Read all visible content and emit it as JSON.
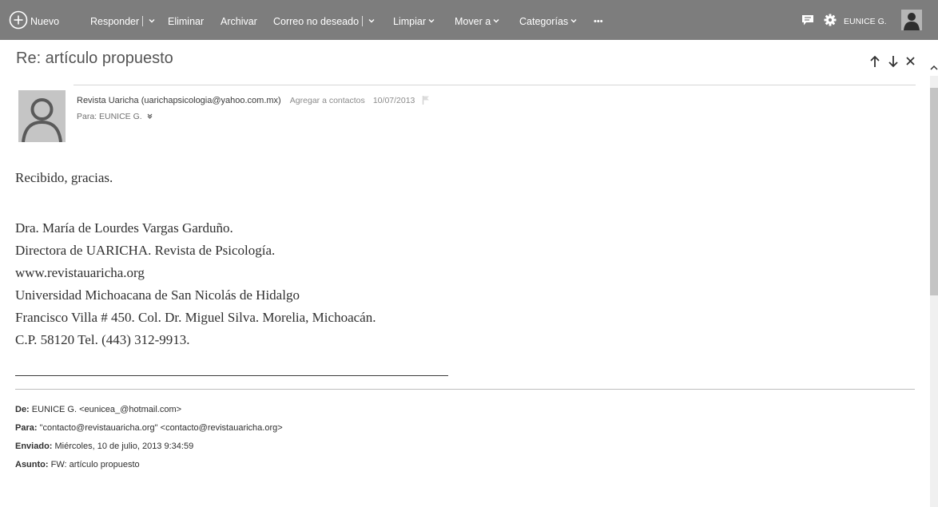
{
  "toolbar": {
    "new_label": "Nuevo",
    "reply_label": "Responder",
    "delete_label": "Eliminar",
    "archive_label": "Archivar",
    "junk_label": "Correo no deseado",
    "sweep_label": "Limpiar",
    "move_label": "Mover a",
    "categories_label": "Categorías",
    "more_label": "•••",
    "user_name": "EUNICE G."
  },
  "email": {
    "subject": "Re: artículo propuesto",
    "sender_name": "Revista Uaricha",
    "sender_email": "(uarichapsicologia@yahoo.com.mx)",
    "add_contact_label": "Agregar a contactos",
    "date": "10/07/2013",
    "to_line": "Para: EUNICE G.",
    "body": {
      "greeting": "Recibido, gracias.",
      "signature": [
        "Dra. María de Lourdes Vargas Garduño.",
        "Directora de UARICHA. Revista de Psicología.",
        "www.revistauaricha.org",
        "Universidad Michoacana de San Nicolás de Hidalgo",
        "Francisco Villa # 450. Col. Dr. Miguel Silva. Morelia, Michoacán.",
        "C.P. 58120 Tel. (443) 312-9913."
      ]
    },
    "forwarded": {
      "from_label": "De:",
      "from_value": "EUNICE G. <eunicea_@hotmail.com>",
      "to_label": "Para:",
      "to_value": "\"contacto@revistauaricha.org\" <contacto@revistauaricha.org>",
      "sent_label": "Enviado:",
      "sent_value": "Miércoles, 10 de julio, 2013 9:34:59",
      "subject_label": "Asunto:",
      "subject_value": "FW: artículo propuesto"
    }
  },
  "icons": [
    "plus-circle-icon",
    "chevron-down-icon",
    "chat-icon",
    "gear-icon",
    "user-photo-icon",
    "arrow-up-icon",
    "arrow-down-icon",
    "close-icon",
    "flag-icon",
    "avatar-placeholder-icon"
  ],
  "colors": {
    "toolbar_bg": "#7d7d7d",
    "toolbar_text": "#ffffff",
    "subject_text": "#555555"
  }
}
